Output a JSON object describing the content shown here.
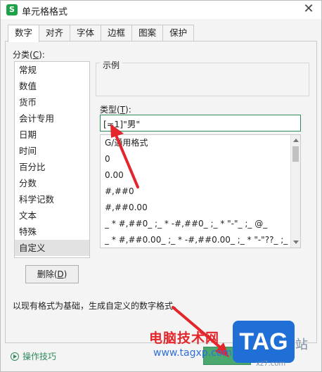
{
  "window": {
    "title": "单元格格式",
    "app_icon": "S"
  },
  "tabs": [
    "数字",
    "对齐",
    "字体",
    "边框",
    "图案",
    "保护"
  ],
  "category": {
    "label": "分类(",
    "accel": "C",
    "label_end": "):",
    "items": [
      "常规",
      "数值",
      "货币",
      "会计专用",
      "日期",
      "时间",
      "百分比",
      "分数",
      "科学记数",
      "文本",
      "特殊",
      "自定义"
    ],
    "selected": "自定义"
  },
  "sample": {
    "label": "示例"
  },
  "type": {
    "label": "类型(",
    "accel": "T",
    "label_end": "):",
    "value": "[=1]\"男\""
  },
  "formats": [
    "G/通用格式",
    "0",
    "0.00",
    "#,##0",
    "#,##0.00",
    "_ * #,##0_ ;_ * -#,##0_ ;_ * \"-\"_ ;_ @_",
    "_ * #,##0.00_ ;_ * -#,##0.00_ ;_ * \"-\"??_ ;_ @_"
  ],
  "delete_button": {
    "label": "删除(",
    "accel": "D",
    "label_end": ")"
  },
  "description": "以现有格式为基础，生成自定义的数字格式。",
  "tips": "操作技巧",
  "watermark": {
    "line1": "电脑技术网",
    "line2": "www.tagxp.com",
    "logo": "TAG",
    "tail": "站",
    "tail2": "xz7.com"
  },
  "colors": {
    "accent": "#2e8a5b",
    "annotation": "#e3262b",
    "watermark_blue": "#1f6fd6"
  }
}
